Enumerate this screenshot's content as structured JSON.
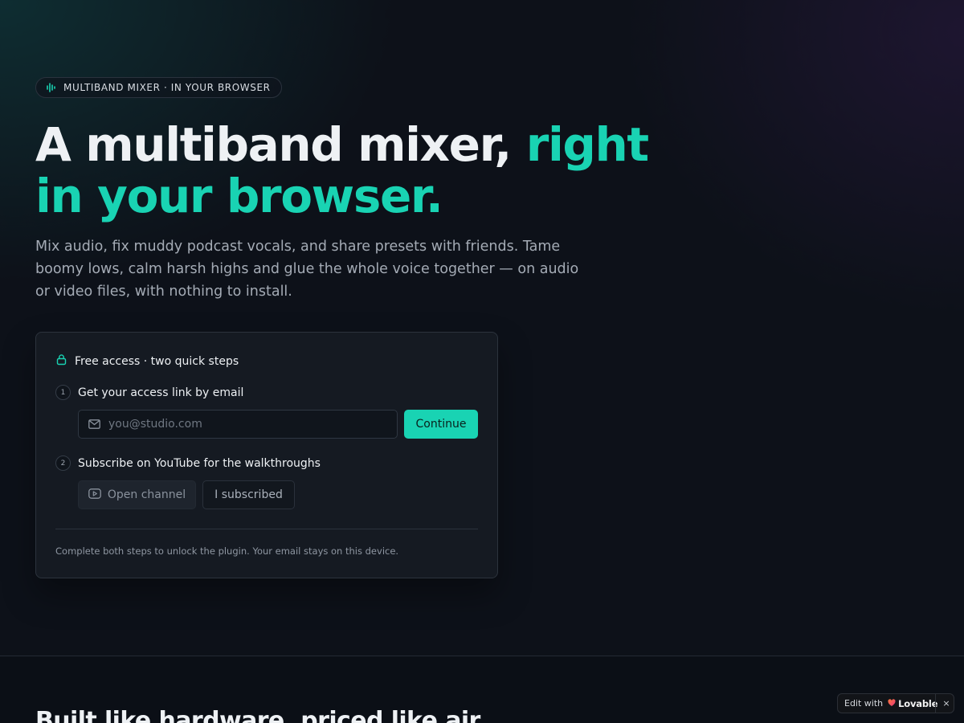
{
  "hero": {
    "eyebrow": "MULTIBAND MIXER · IN YOUR BROWSER",
    "headline_plain": "A multiband mixer, ",
    "headline_accent": "right in your browser.",
    "description": "Mix audio, fix muddy podcast vocals, and share presets with friends. Tame boomy lows, calm harsh highs and glue the whole voice together — on audio or video files, with nothing to install."
  },
  "access_card": {
    "title": "Free access · two quick steps",
    "step1": {
      "number": "1",
      "title": "Get your access link by email",
      "email_placeholder": "you@studio.com",
      "email_value": "",
      "continue_label": "Continue"
    },
    "step2": {
      "number": "2",
      "title": "Subscribe on YouTube for the walkthroughs",
      "open_channel_label": "Open channel",
      "subscribed_label": "I subscribed"
    },
    "footnote": "Complete both steps to unlock the plugin. Your email stays on this device."
  },
  "next_section": {
    "heading": "Built like hardware, priced like air."
  },
  "edit_badge": {
    "label": "Edit with",
    "brand": "Lovable",
    "close": "×"
  },
  "colors": {
    "accent": "#19d3b3",
    "background": "#0d1119",
    "card": "#151a22"
  },
  "icons": {
    "eyebrow": "waveform-icon",
    "card_title": "lock-icon",
    "email": "mail-icon",
    "open_channel": "youtube-play-icon",
    "badge": "lovable-heart-icon"
  }
}
